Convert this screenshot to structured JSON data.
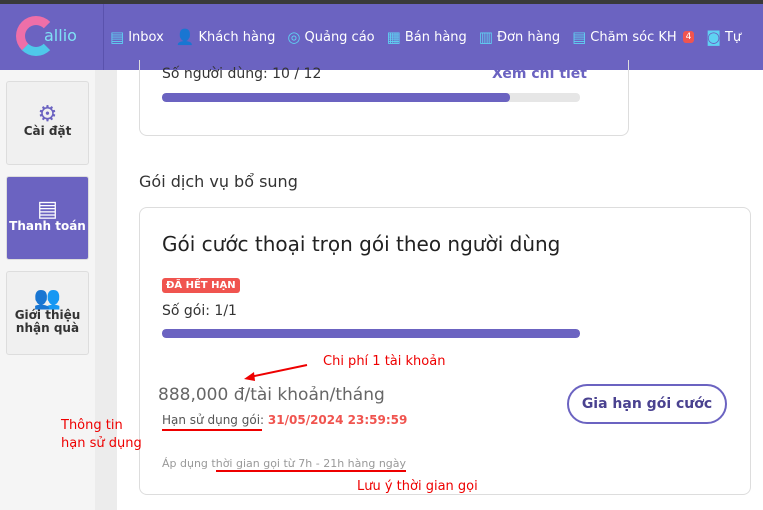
{
  "header": {
    "logo": "Callio",
    "nav": [
      {
        "label": "Inbox",
        "icon": "inbox-icon",
        "glyph": "▤"
      },
      {
        "label": "Khách hàng",
        "icon": "user-icon",
        "glyph": "👤"
      },
      {
        "label": "Quảng cáo",
        "icon": "target-icon",
        "glyph": "◎"
      },
      {
        "label": "Bán hàng",
        "icon": "building-icon",
        "glyph": "▦"
      },
      {
        "label": "Đơn hàng",
        "icon": "receipt-icon",
        "glyph": "▥"
      },
      {
        "label": "Chăm sóc KH",
        "icon": "ticket-icon",
        "glyph": "▤",
        "badge": "4"
      },
      {
        "label": "Tự",
        "icon": "robot-icon",
        "glyph": "◙"
      }
    ]
  },
  "sidebar": [
    {
      "label": "Cài đặt",
      "icon": "gear-icon",
      "glyph": "⚙"
    },
    {
      "label": "Thanh toán",
      "icon": "receipt-icon",
      "glyph": "▤",
      "active": true
    },
    {
      "label": "Giới thiệu nhận quà",
      "icon": "user-plus-icon",
      "glyph": "👥"
    }
  ],
  "card1": {
    "users_label": "Số người dùng: 10 / 12",
    "detail_link": "Xem chi tiết",
    "progress": 0.833
  },
  "section_title": "Gói dịch vụ bổ sung",
  "card2": {
    "title": "Gói cước thoại trọn gói theo người dùng",
    "status": "ĐÃ HẾT HẠN",
    "count_label": "Số gói: 1/1",
    "progress": 1.0,
    "price": "888,000 đ/tài khoản/tháng",
    "expiry_label": "Hạn sử dụng gói:",
    "expiry_value": "31/05/2024 23:59:59",
    "note": "Áp dụng thời gian gọi từ 7h - 21h hàng ngày",
    "renew_button": "Gia hạn gói cước"
  },
  "annotations": {
    "cost": "Chi phí 1 tài khoản",
    "validity_1": "Thông tin",
    "validity_2": "hạn sử dụng",
    "call_time": "Lưu ý thời gian gọi"
  },
  "colors": {
    "brand": "#6b63c1",
    "danger": "#f0544f",
    "annotation": "#e00000"
  }
}
